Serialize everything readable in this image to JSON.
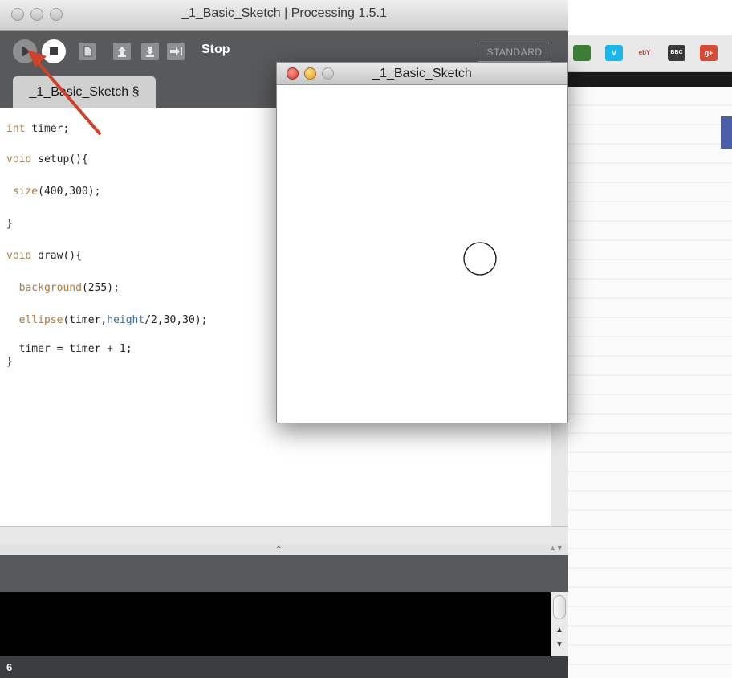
{
  "window": {
    "title": "_1_Basic_Sketch | Processing 1.5.1"
  },
  "toolbar": {
    "stop_label": "Stop",
    "mode_label": "STANDARD"
  },
  "tab": {
    "label": "_1_Basic_Sketch §"
  },
  "editor": {
    "lines": [
      {
        "pre": "",
        "kw": "int",
        "post": " timer;"
      },
      {
        "pre": "",
        "kw": "void",
        "post": " setup(){"
      },
      {
        "pre": " ",
        "kw": "size",
        "post": "(400,300);"
      },
      {
        "pre": "",
        "kw": "",
        "post": "}"
      },
      {
        "pre": "",
        "kw": "void",
        "post": " draw(){"
      },
      {
        "pre": "  ",
        "kw": "background",
        "post": "(255);"
      },
      {
        "pre": "  ",
        "kw": "ellipse",
        "post": "(timer,",
        "blue": "height",
        "tail": "/2,30,30);"
      },
      {
        "pre": "  ",
        "kw": "",
        "post": "timer = timer + 1;"
      },
      {
        "pre": "",
        "kw": "",
        "post": "}"
      }
    ]
  },
  "status": {
    "line_number": "6"
  },
  "sketch_window": {
    "title": "_1_Basic_Sketch"
  },
  "browser": {
    "bookmarks": [
      {
        "icon": "deviantart-icon",
        "text": "",
        "color": "#3e7d38"
      },
      {
        "icon": "vimeo-icon",
        "text": "V",
        "color": "#1ab7ea"
      },
      {
        "icon": "ebay-icon",
        "text": "ebY",
        "color": "#e8e8e8"
      },
      {
        "icon": "bbc-icon",
        "text": "BBC",
        "color": "#3a3a3a"
      },
      {
        "icon": "google-plus-icon",
        "text": "g+",
        "color": "#d64a36"
      }
    ]
  },
  "colors": {
    "toolbar": "#58595b",
    "keyword": "#b07a3b",
    "builtin": "#3b6fa6",
    "arrow": "#d0412b"
  }
}
